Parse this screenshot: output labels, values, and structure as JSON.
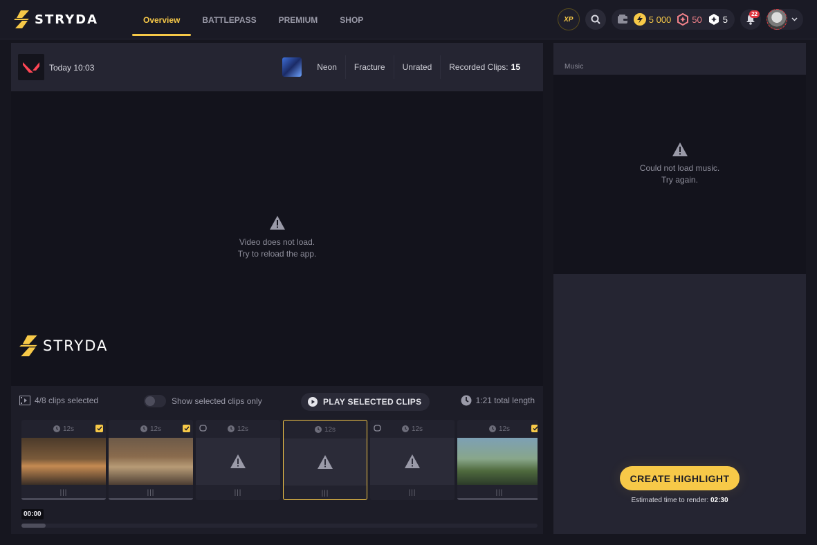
{
  "app": {
    "logo_text": "STRYDA"
  },
  "nav": {
    "tabs": [
      {
        "label": "Overview"
      },
      {
        "label": "BATTLEPASS"
      },
      {
        "label": "PREMIUM"
      },
      {
        "label": "SHOP"
      }
    ],
    "active_tab": "Overview"
  },
  "header": {
    "xp_label": "XP",
    "coins": "5 000",
    "tokens": "50",
    "gems": "5",
    "notifications": "22"
  },
  "match": {
    "time": "Today 10:03",
    "agent": "Neon",
    "map": "Fracture",
    "mode": "Unrated",
    "clips_label": "Recorded Clips:",
    "clips_count": "15"
  },
  "video": {
    "error_line1": "Video does not load.",
    "error_line2": "Try to reload the app.",
    "watermark_text": "STRYDA"
  },
  "clips_toolbar": {
    "selected_text": "4/8 clips selected",
    "toggle_label": "Show selected clips only",
    "play_label": "PLAY SELECTED CLIPS",
    "total_length": "1:21 total length"
  },
  "clips": [
    {
      "duration": "12s",
      "checked": true,
      "state": "thumbnail"
    },
    {
      "duration": "12s",
      "checked": true,
      "state": "thumbnail"
    },
    {
      "duration": "12s",
      "checked": false,
      "state": "error"
    },
    {
      "duration": "12s",
      "checked": false,
      "state": "error"
    },
    {
      "duration": "12s",
      "checked": false,
      "state": "error"
    },
    {
      "duration": "12s",
      "checked": true,
      "state": "thumbnail"
    }
  ],
  "timeline": {
    "current_time": "00:00"
  },
  "music": {
    "label": "Music",
    "error_line1": "Could not load music.",
    "error_line2": "Try again."
  },
  "render": {
    "create_label": "CREATE HIGHLIGHT",
    "estimate_label": "Estimated time to render:",
    "estimate_value": "02:30"
  },
  "colors": {
    "accent": "#f7c948",
    "background": "#16161f",
    "panel": "#252532",
    "video_bg": "#13131c",
    "notification": "#e0353f"
  }
}
